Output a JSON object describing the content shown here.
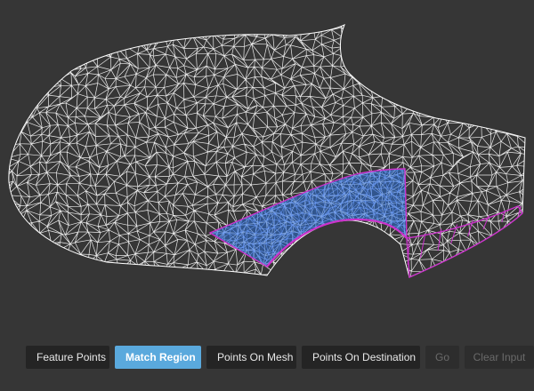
{
  "viewport": {
    "background": "#363636",
    "wire_color": "#ffffff",
    "region_outline_color": "#cc33cc",
    "region_fill_color": "#2e6fd6"
  },
  "toolbar": {
    "feature_points": "Feature Points",
    "match_region": "Match Region",
    "points_on_mesh": "Points On Mesh",
    "points_on_destination": "Points On Destination",
    "go": "Go",
    "clear_input": "Clear Input",
    "active_button": "Match Region",
    "disabled_buttons": [
      "Go",
      "Clear Input"
    ],
    "accent_color": "#5aa9dd"
  }
}
